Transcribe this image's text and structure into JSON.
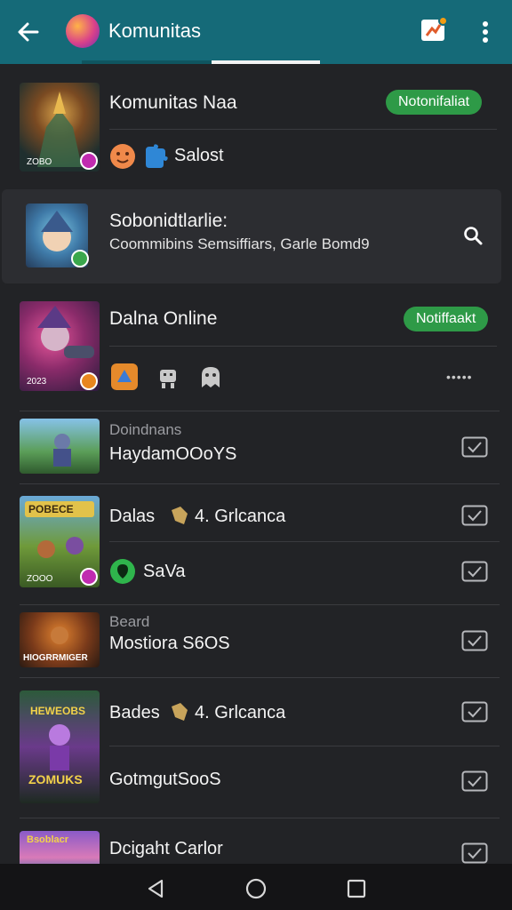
{
  "header": {
    "title": "Komunitas"
  },
  "communities": [
    {
      "name": "Komunitas Naa",
      "badge": "Notonifaliat",
      "status": "Salost"
    },
    {
      "title": "Sobonidtlarlie:",
      "subtitle": "Coommibins Semsiffiars, Garle Bomd9"
    },
    {
      "name": "Dalna Online",
      "badge": "Notiffaakt",
      "more": "•••••"
    }
  ],
  "items": [
    {
      "label": "Doindnans",
      "name": "HaydamOOoYS"
    },
    {
      "name": "Dalas",
      "extra": "4. Grlcanca"
    },
    {
      "name": "SaVa"
    },
    {
      "label": "Beard",
      "name": "Mostiora S6OS"
    },
    {
      "name": "Bades",
      "extra": "4. Grlcanca"
    },
    {
      "name": "GotmgutSooS"
    },
    {
      "name": "Dcigaht Carlor"
    }
  ],
  "thumb_text": {
    "t1": "ZOBO",
    "t3": "2023",
    "t5": "POBECE",
    "t5b": "ZOOO",
    "t6": "HIOGRRMIGER",
    "t7a": "HEWEOBS",
    "t7b": "ZOMUKS",
    "t8": "Bsoblacr"
  },
  "colors": {
    "appbar": "#156a78",
    "background": "#222326",
    "accent_green": "#2e9a47"
  }
}
